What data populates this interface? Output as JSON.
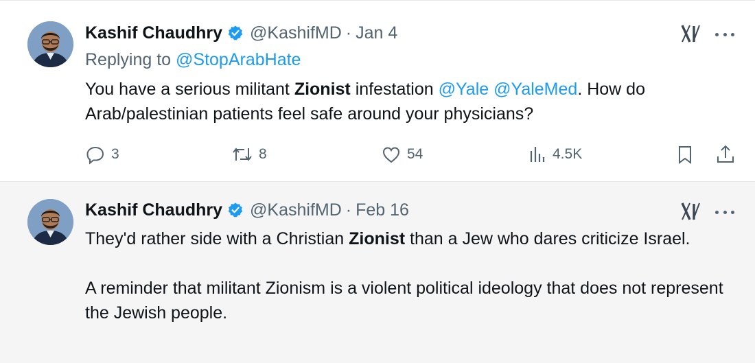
{
  "colors": {
    "link": "#1d9bf0",
    "muted": "#536471",
    "text": "#0f1419",
    "verified": "#1d9bf0"
  },
  "tweets": [
    {
      "author_name": "Kashif Chaudhry",
      "handle": "@KashifMD",
      "separator": "·",
      "date": "Jan 4",
      "replying_prefix": "Replying to",
      "replying_handle": "@StopArabHate",
      "text_parts": {
        "p1": "You have a serious militant ",
        "bold": "Zionist",
        "p2": " infestation ",
        "mention1": "@Yale",
        "mention2": "@YaleMed",
        "p3": ". How do Arab/palestinian patients feel safe around your physicians?"
      },
      "metrics": {
        "replies": "3",
        "retweets": "8",
        "likes": "54",
        "views": "4.5K"
      },
      "icons": [
        "verified-badge-icon",
        "x-logo-icon",
        "more-icon",
        "reply-icon",
        "retweet-icon",
        "like-icon",
        "views-icon",
        "bookmark-icon",
        "share-icon"
      ]
    },
    {
      "author_name": "Kashif Chaudhry",
      "handle": "@KashifMD",
      "separator": "·",
      "date": "Feb 16",
      "text_parts": {
        "p1": "They'd rather side with a Christian ",
        "bold": "Zionist",
        "p2": " than a Jew who dares criticize Israel.",
        "p3": "A reminder that militant Zionism is a violent political ideology that does not represent the Jewish people."
      },
      "icons": [
        "verified-badge-icon",
        "x-logo-icon",
        "more-icon"
      ]
    }
  ]
}
